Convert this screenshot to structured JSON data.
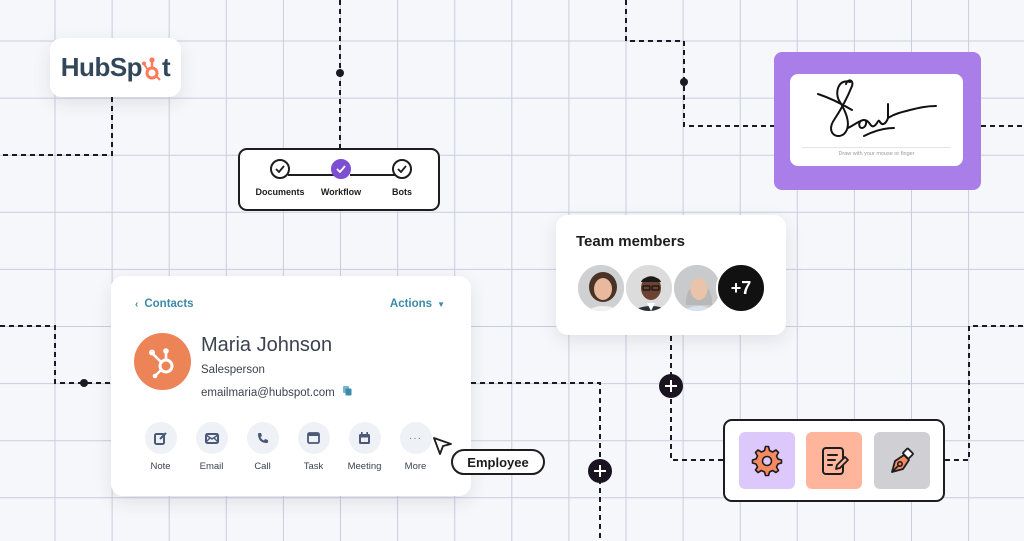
{
  "brand": {
    "logo_text_prefix": "HubSp",
    "logo_text_suffix": "t",
    "logo_color": "#33475b",
    "accent": "#ff7a59"
  },
  "stepper": {
    "steps": [
      {
        "label": "Documents",
        "state": "done"
      },
      {
        "label": "Workflow",
        "state": "active"
      },
      {
        "label": "Bots",
        "state": "done"
      }
    ],
    "active_color": "#7d4ed4"
  },
  "signature": {
    "hint": "Draw with your mouse or finger",
    "frame_color": "#a97ee9"
  },
  "team": {
    "title": "Team members",
    "members": [
      {
        "name": "woman-curly-hair-icon"
      },
      {
        "name": "man-glasses-icon"
      },
      {
        "name": "woman-grey-hair-icon"
      }
    ],
    "more_label": "+7"
  },
  "contact": {
    "back_label": "Contacts",
    "actions_label": "Actions",
    "name": "Maria Johnson",
    "role": "Salesperson",
    "email": "emailmaria@hubspot.com",
    "avatar_color": "#ec8458",
    "link_color": "#3d8aa8",
    "actions": [
      {
        "label": "Note",
        "icon": "note-icon"
      },
      {
        "label": "Email",
        "icon": "email-icon"
      },
      {
        "label": "Call",
        "icon": "call-icon"
      },
      {
        "label": "Task",
        "icon": "task-icon"
      },
      {
        "label": "Meeting",
        "icon": "meeting-icon"
      },
      {
        "label": "More",
        "icon": "more-icon"
      }
    ]
  },
  "tag": {
    "label": "Employee"
  },
  "tools": [
    {
      "name": "settings",
      "bg": "#dcc8fb"
    },
    {
      "name": "document-edit",
      "bg": "#ffb59c"
    },
    {
      "name": "pen-tool",
      "bg": "#d0d0d4"
    }
  ]
}
